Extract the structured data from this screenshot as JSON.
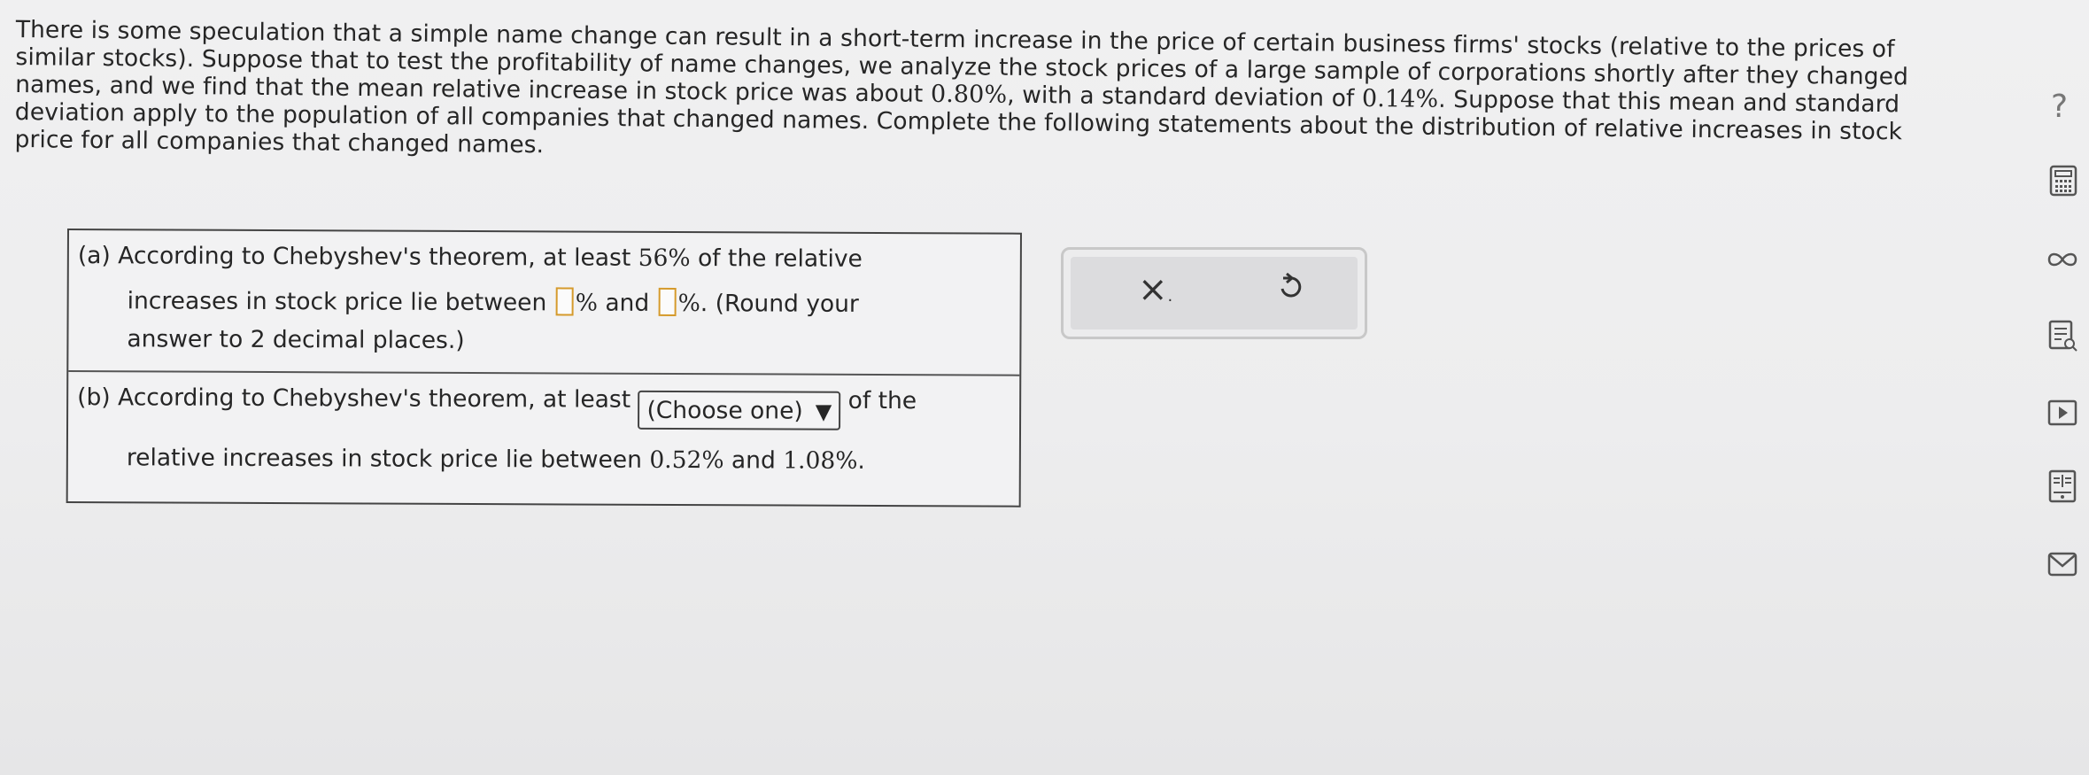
{
  "problem": {
    "intro_segments": {
      "s1": "There is some speculation that a simple name change can result in a short-term increase in the price of certain business firms' stocks (relative to the prices of similar stocks). Suppose that to test the profitability of name changes, we analyze the stock prices of a large sample of corporations shortly after they changed names, and we find that the mean relative increase in stock price was about ",
      "mean": "0.80%",
      "s2": ", with a standard deviation of ",
      "sd": "0.14%",
      "s3": ". Suppose that this mean and standard deviation apply to the population of all companies that changed names. Complete the following statements about the distribution of relative increases in stock price for all companies that changed names."
    }
  },
  "part_a": {
    "line1_prefix": "(a) According to Chebyshev's theorem, at least ",
    "line1_pct": "56%",
    "line1_suffix": " of the relative",
    "line2_prefix": "increases in stock price lie between ",
    "pct_sign_1": "%",
    "and_text": " and ",
    "pct_sign_2": "%",
    "line2_suffix": ". (Round your",
    "line3": "answer to 2 decimal places.)",
    "input1_value": "",
    "input2_value": ""
  },
  "part_b": {
    "line1_prefix": "(b) According to Chebyshev's theorem, at least ",
    "select_value": "(Choose one)",
    "line1_suffix": " of the",
    "line2_prefix": "relative increases in stock price lie between ",
    "low": "0.52%",
    "and_text": " and ",
    "high": "1.08%",
    "line2_suffix": "."
  },
  "actions": {
    "x_symbol": "×",
    "x_dot": "."
  },
  "sidebar": {
    "help_symbol": "?",
    "icons": [
      "help-icon",
      "calculator-icon",
      "infinity-icon",
      "notes-icon",
      "video-icon",
      "ebook-icon",
      "mail-icon"
    ]
  }
}
